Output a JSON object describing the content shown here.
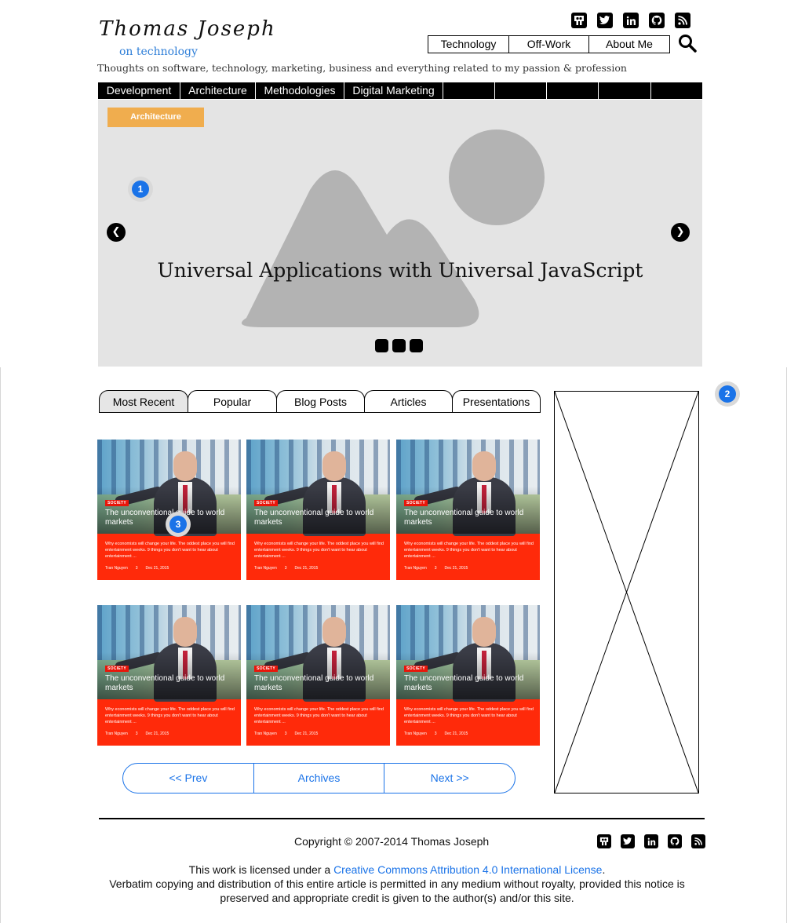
{
  "header": {
    "logo_name": "Thomas Joseph",
    "logo_sub": "on technology",
    "tagline": "Thoughts on software, technology, marketing, business and everything related to my passion & profession",
    "social_icons": [
      "slideshare-icon",
      "twitter-icon",
      "linkedin-icon",
      "github-icon",
      "rss-icon"
    ],
    "top_menu": [
      "Technology",
      "Off-Work",
      "About Me"
    ]
  },
  "category_bar": {
    "items": [
      "Development",
      "Architecture",
      "Methodologies",
      "Digital Marketing",
      "",
      "",
      "",
      "",
      ""
    ]
  },
  "hero": {
    "tag": "Architecture",
    "title": "Universal Applications with Universal JavaScript",
    "prev_icon": "chevron-left-icon",
    "next_icon": "chevron-right-icon",
    "dot_count": 3
  },
  "markers": [
    "1",
    "2",
    "3"
  ],
  "tabs": {
    "items": [
      "Most Recent",
      "Popular",
      "Blog Posts",
      "Articles",
      "Presentations"
    ],
    "active": "Most Recent"
  },
  "cards": [
    {
      "badge": "SOCIETY",
      "title": "The unconventional guide to world markets",
      "excerpt": "Why economists will change your life. The oddest place you will find entertainment weeks. 9 things you don't want to hear about entertainment ...",
      "author": "Tran Nguyen",
      "comments": "3",
      "date": "Dec 21, 2015"
    },
    {
      "badge": "SOCIETY",
      "title": "The unconventional guide to world markets",
      "excerpt": "Why economists will change your life. The oddest place you will find entertainment weeks. 9 things you don't want to hear about entertainment ...",
      "author": "Tran Nguyen",
      "comments": "3",
      "date": "Dec 21, 2015"
    },
    {
      "badge": "SOCIETY",
      "title": "The unconventional guide to world markets",
      "excerpt": "Why economists will change your life. The oddest place you will find entertainment weeks. 9 things you don't want to hear about entertainment ...",
      "author": "Tran Nguyen",
      "comments": "3",
      "date": "Dec 21, 2015"
    },
    {
      "badge": "SOCIETY",
      "title": "The unconventional guide to world markets",
      "excerpt": "Why economists will change your life. The oddest place you will find entertainment weeks. 9 things you don't want to hear about entertainment ...",
      "author": "Tran Nguyen",
      "comments": "3",
      "date": "Dec 21, 2015"
    },
    {
      "badge": "SOCIETY",
      "title": "The unconventional guide to world markets",
      "excerpt": "Why economists will change your life. The oddest place you will find entertainment weeks. 9 things you don't want to hear about entertainment ...",
      "author": "Tran Nguyen",
      "comments": "3",
      "date": "Dec 21, 2015"
    },
    {
      "badge": "SOCIETY",
      "title": "The unconventional guide to world markets",
      "excerpt": "Why economists will change your life. The oddest place you will find entertainment weeks. 9 things you don't want to hear about entertainment ...",
      "author": "Tran Nguyen",
      "comments": "3",
      "date": "Dec 21, 2015"
    }
  ],
  "pager": [
    "<< Prev",
    "Archives",
    "Next >>"
  ],
  "footer": {
    "copyright": "Copyright © 2007-2014 Thomas Joseph",
    "license_prefix": "This work is licensed under a ",
    "license_link": "Creative Commons Attribution 4.0 International License",
    "license_suffix": ".",
    "verbatim": "Verbatim copying and distribution of this entire article is permitted in any medium without royalty, provided this notice is preserved and appropriate credit is given to the author(s) and/or this site."
  },
  "colors": {
    "accent_blue": "#1a73e8",
    "tag_orange": "#f0ad4e",
    "card_red": "#ff2a0a",
    "bar_black": "#000000"
  }
}
